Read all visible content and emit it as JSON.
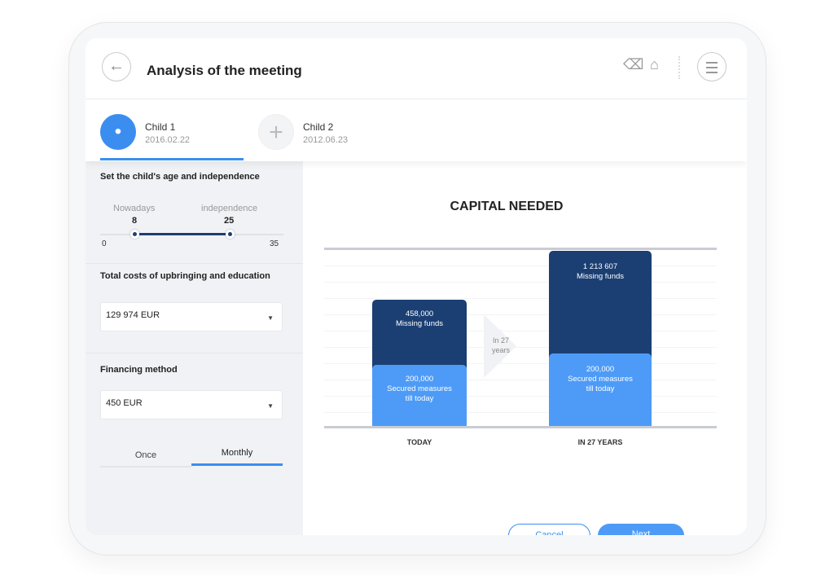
{
  "header": {
    "title": "Analysis of the meeting",
    "back_icon": "arrow-left-icon",
    "icons": [
      "eraser-icon",
      "home-icon",
      "menu-icon"
    ]
  },
  "children": [
    {
      "name": "Child 1",
      "date": "2016.02.22",
      "active": true
    },
    {
      "name": "Child 2",
      "date": "2012.06.23",
      "active": false
    }
  ],
  "left": {
    "age_title": "Set the child's age and independence",
    "nowadays_label": "Nowadays",
    "nowadays_value": "8",
    "independence_label": "independence",
    "independence_value": "25",
    "min": "0",
    "max": "35",
    "costs_title": "Total costs of upbringing and education",
    "costs_value": "129 974 EUR",
    "financing_title": "Financing method",
    "financing_value": "450 EUR",
    "segments": [
      "Once",
      "Monthly"
    ],
    "selected_segment": "Monthly"
  },
  "chart_data": {
    "type": "bar",
    "stacked": true,
    "title": "CAPITAL NEEDED",
    "categories": [
      "TODAY",
      "IN 27 YEARS"
    ],
    "series": [
      {
        "name": "Secured measures till today",
        "values": [
          200000,
          200000
        ],
        "labels": [
          "200,000",
          "200,000"
        ],
        "color": "#4d9bf7"
      },
      {
        "name": "Missing funds",
        "values": [
          458000,
          1213607
        ],
        "labels": [
          "458,000",
          "1 213 607"
        ],
        "color": "#1b3f72"
      }
    ],
    "arrow_text": "In 27 years"
  },
  "chart_labels": {
    "secured_line1": "Secured measures",
    "secured_line2": "till today",
    "missing": "Missing funds",
    "arrow1": "In 27",
    "arrow2": "years"
  },
  "buttons": {
    "cancel": "Cancel",
    "next": "Next"
  },
  "colors": {
    "accent": "#3b8ef0",
    "dark_bar": "#1b3f72",
    "light_bar": "#4d9bf7"
  }
}
